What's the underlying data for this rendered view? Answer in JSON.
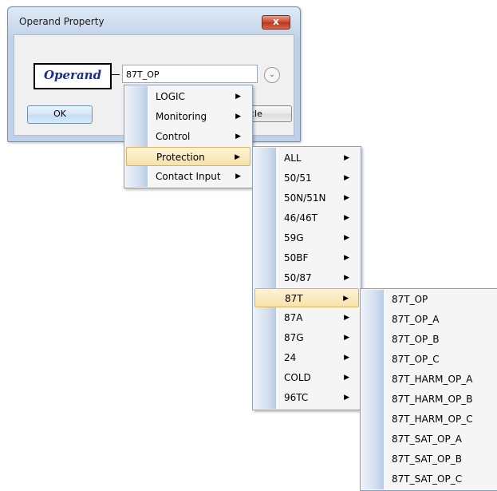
{
  "dialog": {
    "title": "Operand Property",
    "close_glyph": "x",
    "operand_label": "Operand",
    "operand_value": "87T_OP",
    "dropdown_glyph": "⌄",
    "ok_label": "OK",
    "cancel_label_visible": "ncle"
  },
  "menu1": {
    "items": [
      {
        "label": "LOGIC",
        "has_submenu": true
      },
      {
        "label": "Monitoring",
        "has_submenu": true
      },
      {
        "label": "Control",
        "has_submenu": true
      },
      {
        "label": "Protection",
        "has_submenu": true,
        "selected": true
      },
      {
        "label": "Contact Input",
        "has_submenu": true
      }
    ]
  },
  "menu2": {
    "items": [
      {
        "label": "ALL",
        "has_submenu": true
      },
      {
        "label": "50/51",
        "has_submenu": true
      },
      {
        "label": "50N/51N",
        "has_submenu": true
      },
      {
        "label": "46/46T",
        "has_submenu": true
      },
      {
        "label": "59G",
        "has_submenu": true
      },
      {
        "label": "50BF",
        "has_submenu": true
      },
      {
        "label": "50/87",
        "has_submenu": true
      },
      {
        "label": "87T",
        "has_submenu": true,
        "selected": true
      },
      {
        "label": "87A",
        "has_submenu": true
      },
      {
        "label": "87G",
        "has_submenu": true
      },
      {
        "label": "24",
        "has_submenu": true
      },
      {
        "label": "COLD",
        "has_submenu": true
      },
      {
        "label": "96TC",
        "has_submenu": true
      }
    ]
  },
  "menu3": {
    "items": [
      {
        "label": "87T_OP"
      },
      {
        "label": "87T_OP_A"
      },
      {
        "label": "87T_OP_B"
      },
      {
        "label": "87T_OP_C"
      },
      {
        "label": "87T_HARM_OP_A"
      },
      {
        "label": "87T_HARM_OP_B"
      },
      {
        "label": "87T_HARM_OP_C"
      },
      {
        "label": "87T_SAT_OP_A"
      },
      {
        "label": "87T_SAT_OP_B"
      },
      {
        "label": "87T_SAT_OP_C"
      }
    ]
  },
  "arrow_glyph": "▶",
  "colors": {
    "selection_fill": "#f7e2a8",
    "selection_border": "#d7b45e",
    "operand_text": "#1a2e8a",
    "menu_border": "#8aa0bb"
  }
}
